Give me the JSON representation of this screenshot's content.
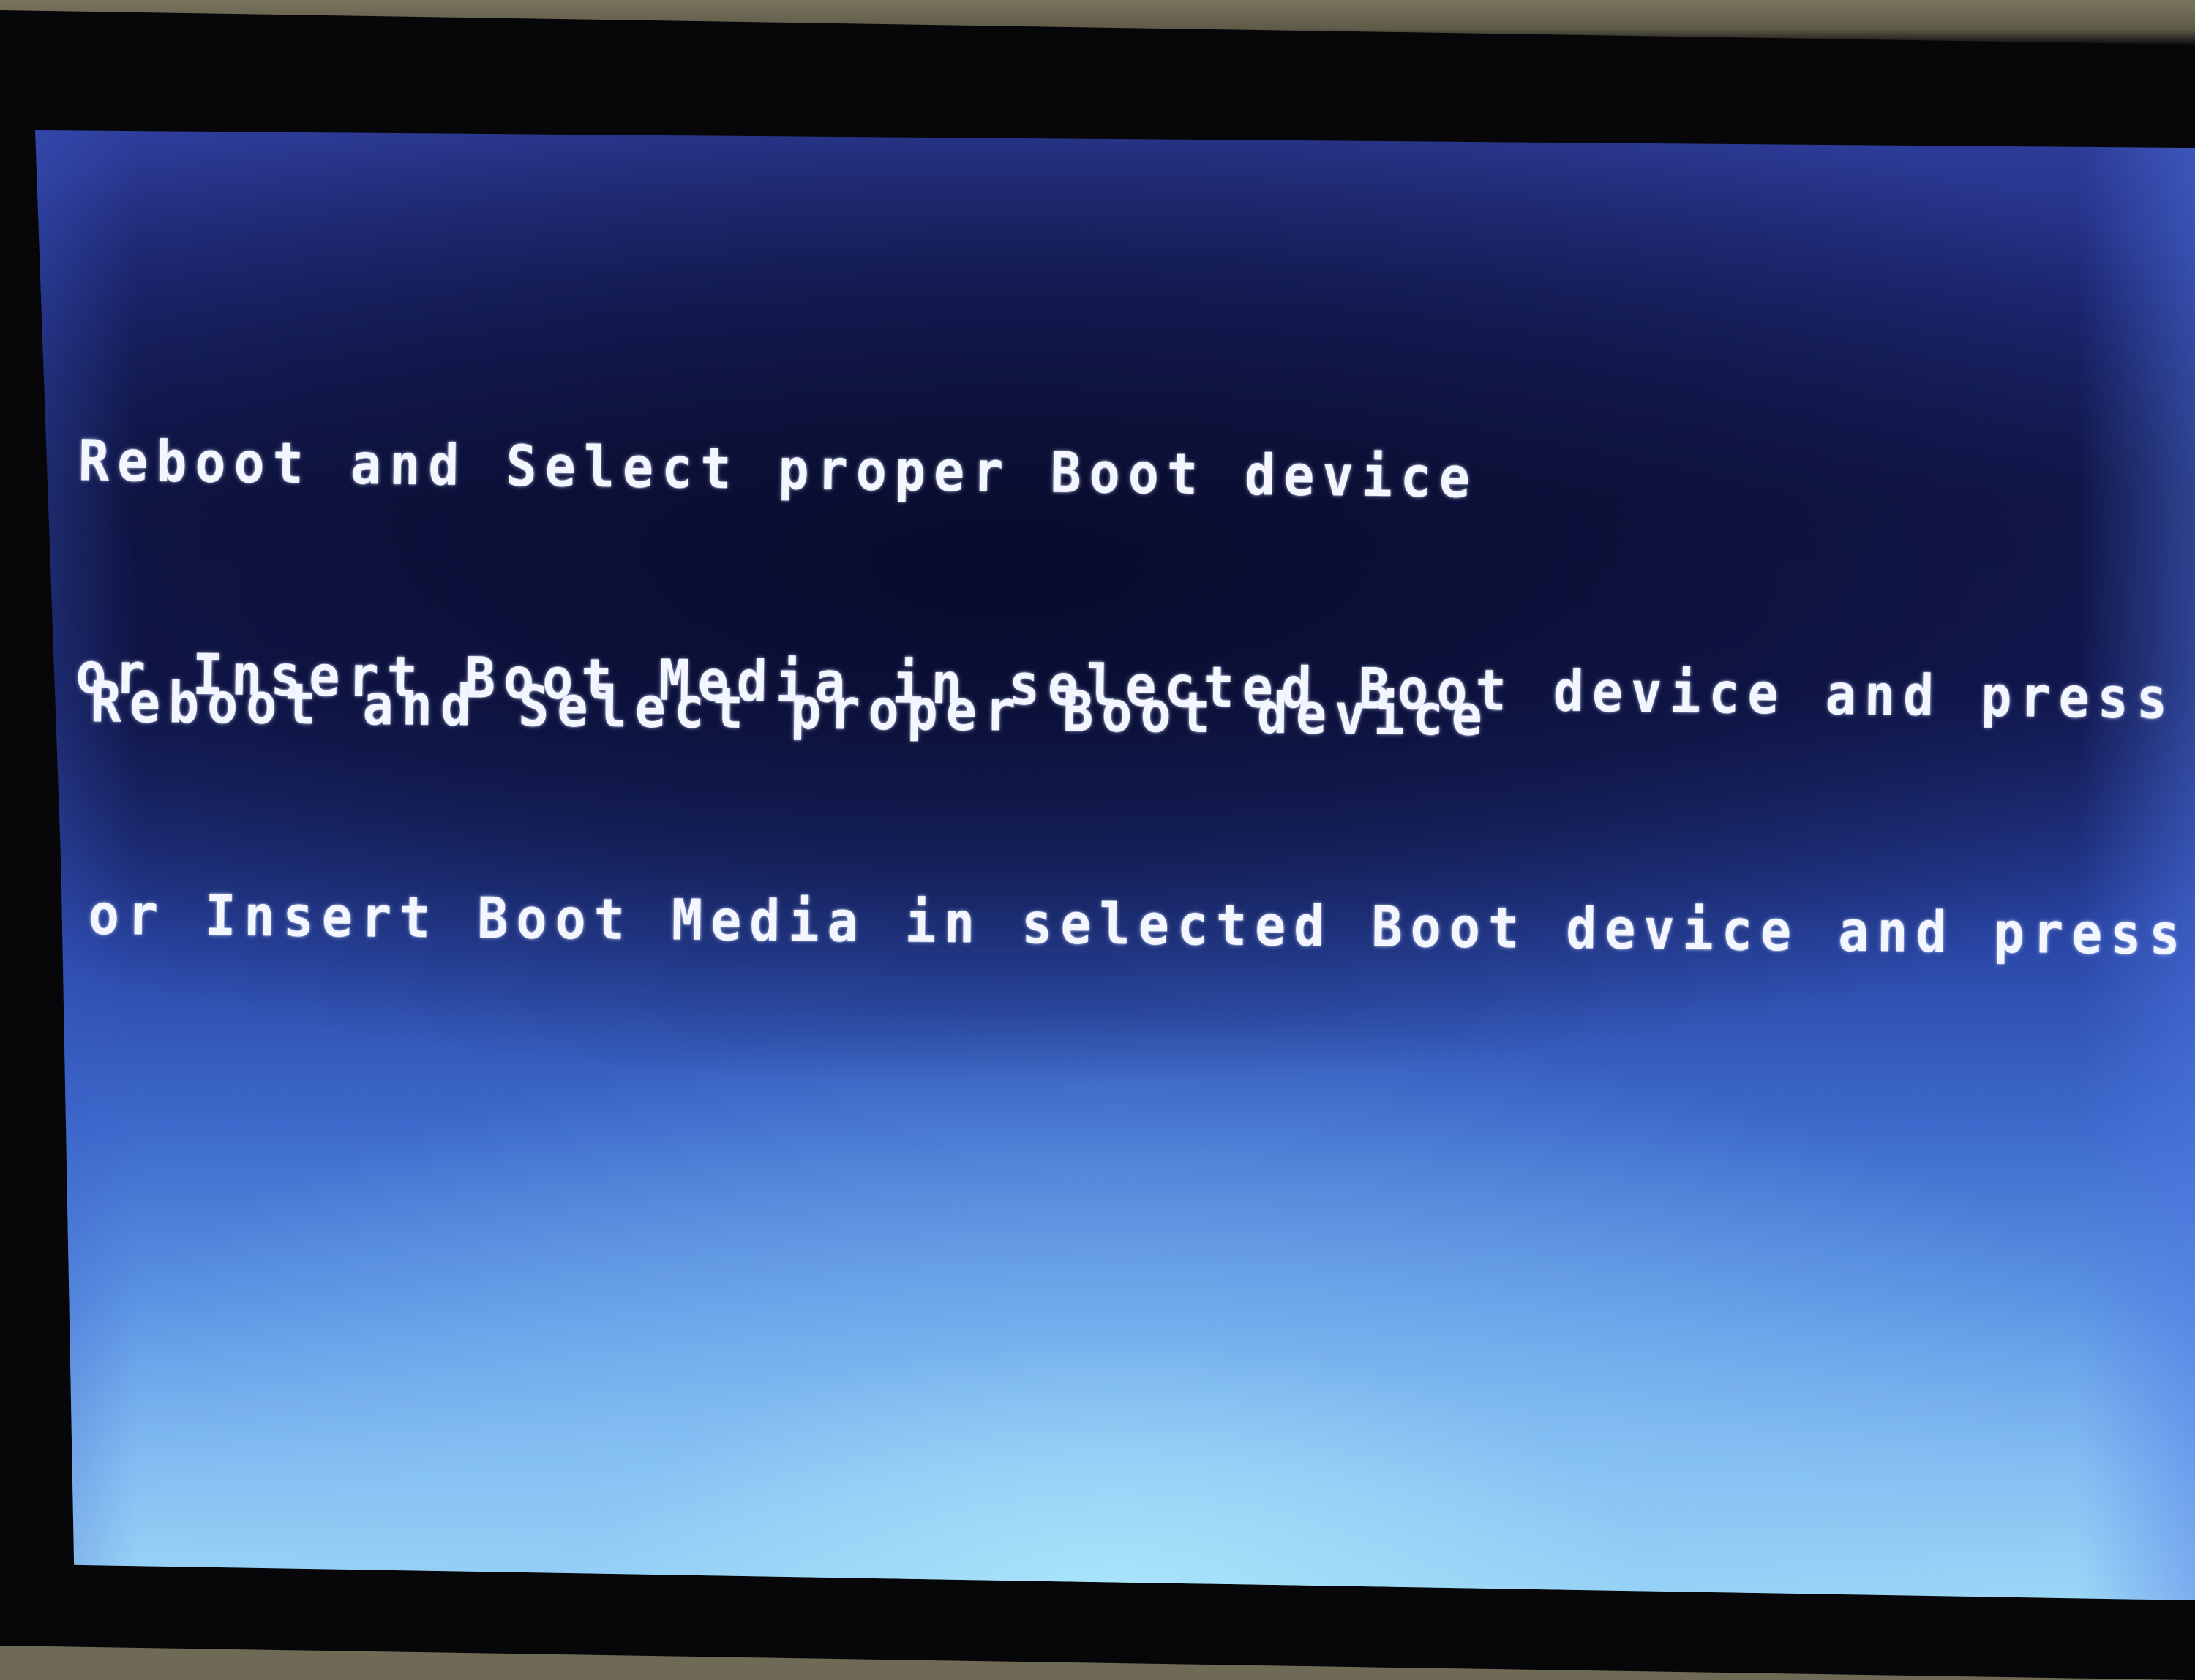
{
  "screen": {
    "type": "bios-boot-error",
    "background_colors": {
      "top": "#2e3d9a",
      "middle_dark": "#141a52",
      "bottom_light": "#9fdaf7"
    },
    "text_color": "#f4f6ff"
  },
  "messages": [
    {
      "line1": "Reboot and Select proper Boot device",
      "line2": "or Insert Boot Media in selected Boot device and press a key"
    },
    {
      "line1": "Reboot and Select proper Boot device",
      "line2": "or Insert Boot Media in selected Boot device and press a key"
    }
  ]
}
